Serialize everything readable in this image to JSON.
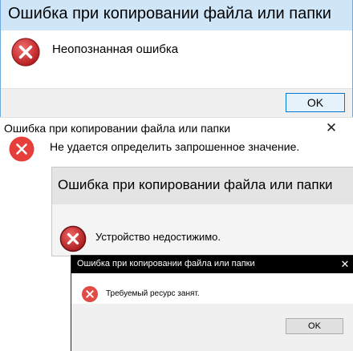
{
  "dialogs": [
    {
      "title": "Ошибка при копировании файла или папки",
      "message": "Неопознанная ошибка",
      "icon": "error-icon",
      "ok_label": "OK"
    },
    {
      "title": "Ошибка при копировании файла или папки",
      "message": "Не удается определить запрошенное значение.",
      "icon": "error-icon",
      "close_glyph": "✕"
    },
    {
      "title": "Ошибка при копировании файла или папки",
      "message": "Устройство недостижимо.",
      "icon": "error-icon"
    },
    {
      "title": "Ошибка при копировании файла или папки",
      "message": "Требуемый ресурс занят.",
      "icon": "error-icon",
      "close_glyph": "✕",
      "ok_label": "OK"
    }
  ],
  "colors": {
    "error_icon_fill": "#d9373a",
    "win8_titlebar": "#cfe6f8",
    "dark_titlebar": "#000000"
  }
}
